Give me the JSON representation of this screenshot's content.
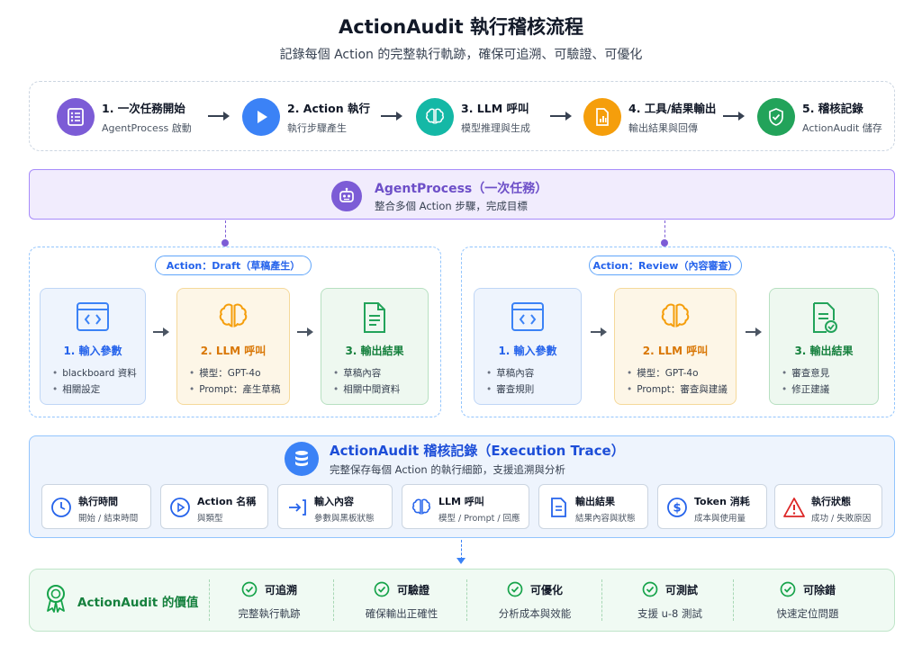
{
  "header": {
    "title": "ActionAudit 執行稽核流程",
    "subtitle": "記錄每個 Action 的完整執行軌跡，確保可追溯、可驗證、可優化"
  },
  "flow": {
    "steps": [
      {
        "title": "1. 一次任務開始",
        "sub": "AgentProcess 啟動",
        "icon": "list-icon",
        "color": "#7c5cd6"
      },
      {
        "title": "2. Action 執行",
        "sub": "執行步驟產生",
        "icon": "play-icon",
        "color": "#3b82f6"
      },
      {
        "title": "3. LLM 呼叫",
        "sub": "模型推理與生成",
        "icon": "brain-icon",
        "color": "#14b8a6"
      },
      {
        "title": "4. 工具/結果輸出",
        "sub": "輸出結果與回傳",
        "icon": "document-chart-icon",
        "color": "#f59e0b"
      },
      {
        "title": "5. 稽核記錄",
        "sub": "ActionAudit 儲存",
        "icon": "shield-check-icon",
        "color": "#22a35a"
      }
    ]
  },
  "agent": {
    "title": "AgentProcess（一次任務）",
    "sub": "整合多個 Action 步驟，完成目標",
    "icon": "robot-icon"
  },
  "actions": [
    {
      "label": "Action：Draft（草稿產生）",
      "cards": [
        {
          "title": "1. 輸入參數",
          "items": [
            "blackboard 資料",
            "相關設定"
          ],
          "icon": "code-window-icon"
        },
        {
          "title": "2. LLM 呼叫",
          "items": [
            "模型：GPT-4o",
            "Prompt：產生草稿"
          ],
          "icon": "brain-icon"
        },
        {
          "title": "3. 輸出結果",
          "items": [
            "草稿內容",
            "相關中間資料"
          ],
          "icon": "document-icon"
        }
      ]
    },
    {
      "label": "Action：Review（內容審查）",
      "cards": [
        {
          "title": "1. 輸入參數",
          "items": [
            "草稿內容",
            "審查規則"
          ],
          "icon": "code-window-icon"
        },
        {
          "title": "2. LLM 呼叫",
          "items": [
            "模型：GPT-4o",
            "Prompt：審查與建議"
          ],
          "icon": "brain-icon"
        },
        {
          "title": "3. 輸出結果",
          "items": [
            "審查意見",
            "修正建議"
          ],
          "icon": "document-check-icon"
        }
      ]
    }
  ],
  "trace": {
    "title": "ActionAudit 稽核記錄（Execution Trace）",
    "sub": "完整保存每個 Action 的執行細節，支援追溯與分析",
    "icon": "database-icon",
    "items": [
      {
        "title": "執行時間",
        "sub": "開始 / 結束時間",
        "icon": "clock-icon"
      },
      {
        "title": "Action 名稱",
        "sub": "與類型",
        "icon": "play-circle-icon"
      },
      {
        "title": "輸入內容",
        "sub": "參數與黑板狀態",
        "icon": "input-arrow-icon"
      },
      {
        "title": "LLM 呼叫",
        "sub": "模型 / Prompt / 回應",
        "icon": "brain-icon"
      },
      {
        "title": "輸出結果",
        "sub": "結果內容與狀態",
        "icon": "document-icon"
      },
      {
        "title": "Token 消耗",
        "sub": "成本與使用量",
        "icon": "dollar-circle-icon"
      },
      {
        "title": "執行狀態",
        "sub": "成功 / 失敗原因",
        "icon": "warning-icon"
      }
    ]
  },
  "value": {
    "title": "ActionAudit 的價值",
    "icon": "award-ribbon-icon",
    "items": [
      {
        "name": "可追溯",
        "desc": "完整執行軌跡"
      },
      {
        "name": "可驗證",
        "desc": "確保輸出正確性"
      },
      {
        "name": "可優化",
        "desc": "分析成本與效能"
      },
      {
        "name": "可測試",
        "desc": "支援 u-8 測試"
      },
      {
        "name": "可除錯",
        "desc": "快速定位問題"
      }
    ]
  }
}
